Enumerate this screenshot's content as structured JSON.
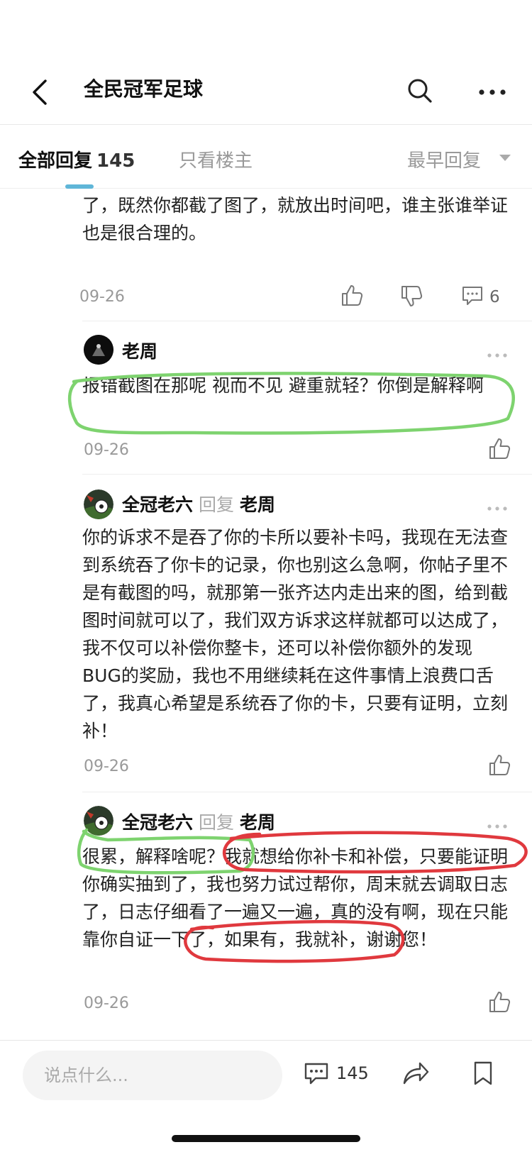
{
  "nav": {
    "title": "全民冠军足球"
  },
  "tabs": {
    "all_label": "全部回复",
    "all_count": "145",
    "op_only": "只看楼主",
    "sort": "最早回复"
  },
  "post": {
    "partial_text": "了，既然你都截了图了，就放出时间吧，谁主张谁举证也是很合理的。",
    "date": "09-26",
    "comment_count": "6"
  },
  "replies": [
    {
      "user": "老周",
      "reply_word": "",
      "reply_to": "",
      "text": "报错截图在那呢 视而不见 避重就轻？你倒是解释啊",
      "date": "09-26"
    },
    {
      "user": "全冠老六",
      "reply_word": "回复",
      "reply_to": "老周",
      "text": "你的诉求不是吞了你的卡所以要补卡吗，我现在无法查到系统吞了你卡的记录，你也别这么急啊，你帖子里不是有截图的吗，就那第一张齐达内走出来的图，给到截图时间就可以了，我们双方诉求这样就都可以达成了，我不仅可以补偿你整卡，还可以补偿你额外的发现BUG的奖励，我也不用继续耗在这件事情上浪费口舌了，我真心希望是系统吞了你的卡，只要有证明，立刻补！",
      "date": "09-26"
    },
    {
      "user": "全冠老六",
      "reply_word": "回复",
      "reply_to": "老周",
      "text": "很累，解释啥呢？我就想给你补卡和补偿，只要能证明你确实抽到了，我也努力试过帮你，周末就去调取日志了，日志仔细看了一遍又一遍，真的没有啊，现在只能靠你自证一下了，如果有，我就补，谢谢您！",
      "date": "09-26"
    }
  ],
  "bottom": {
    "placeholder": "说点什么...",
    "comment_count": "145"
  },
  "colors": {
    "accent": "#5fb6d8",
    "green_annotation": "#7ed36f",
    "red_annotation": "#e0393e"
  }
}
